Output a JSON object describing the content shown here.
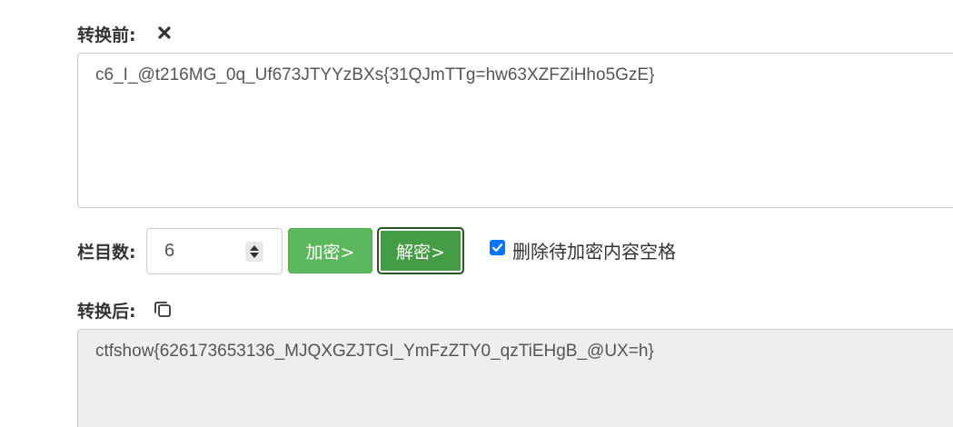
{
  "before": {
    "label": "转换前:",
    "text": "c6_I_@t216MG_0q_Uf673JTYYzBXs{31QJmTTg=hw63XZFZiHho5GzE}"
  },
  "controls": {
    "columns_label": "栏目数:",
    "columns_value": "6",
    "encrypt_label": "加密>",
    "decrypt_label": "解密>",
    "checkbox_label": "删除待加密内容空格",
    "checkbox_checked": true
  },
  "after": {
    "label": "转换后:",
    "text": "ctfshow{626173653136_MJQXGZJTGI_YmFzZTY0_qzTiEHgB_@UX=h}"
  },
  "colors": {
    "encrypt_button": "#5cb85c",
    "decrypt_button": "#449d44",
    "checkbox": "#0075ff",
    "output_background": "#eeeeee"
  },
  "icons": {
    "clear": "close-icon",
    "copy": "copy-icon"
  }
}
